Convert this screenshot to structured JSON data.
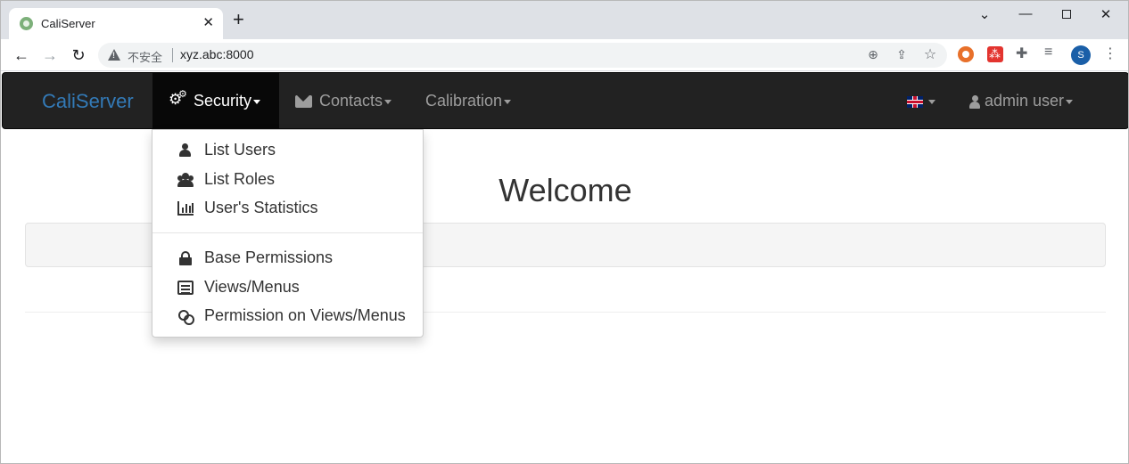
{
  "browser": {
    "tab_title": "CaliServer",
    "tab_close": "✕",
    "new_tab": "+",
    "security_label": "不安全",
    "url": "xyz.abc:8000",
    "profile_initial": "S",
    "icons": [
      "back-icon",
      "forward-icon",
      "reload-icon",
      "warning-icon",
      "zoom-icon",
      "share-icon",
      "star-icon",
      "puzzle-icon",
      "media-icon",
      "kebab-icon"
    ]
  },
  "navbar": {
    "brand": "CaliServer",
    "security": "Security",
    "contacts": "Contacts",
    "calibration": "Calibration",
    "user": "admin user"
  },
  "security_menu": {
    "list_users": "List Users",
    "list_roles": "List Roles",
    "user_statistics": "User's Statistics",
    "base_permissions": "Base Permissions",
    "views_menus": "Views/Menus",
    "permission_views_menus": "Permission on Views/Menus"
  },
  "main": {
    "heading": "Welcome"
  },
  "colors": {
    "navbar_bg": "#222222",
    "brand": "#337ab7",
    "nav_text": "#9d9d9d",
    "active_bg": "#080808",
    "profile": "#1a5fa8"
  }
}
